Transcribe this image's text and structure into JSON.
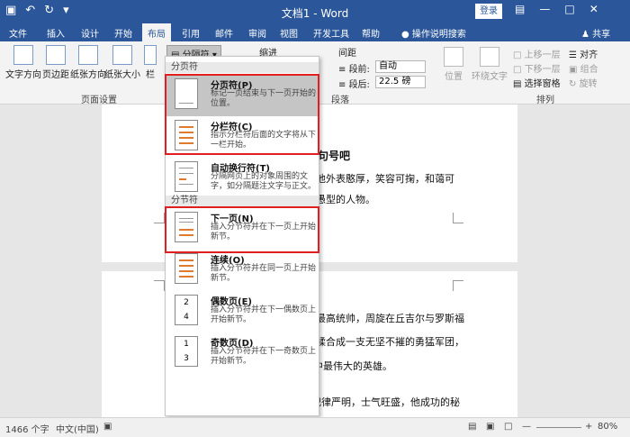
{
  "titlebar": {
    "title": "文档1 - Word",
    "login": "登录"
  },
  "tabs": [
    "文件",
    "插入",
    "设计",
    "开始",
    "布局",
    "引用",
    "邮件",
    "审阅",
    "视图",
    "开发工具",
    "帮助"
  ],
  "tell_me": "操作说明搜索",
  "share": "共享",
  "ribbon": {
    "text_direction": "文字方向",
    "margins": "页边距",
    "orientation": "纸张方向",
    "size": "纸张大小",
    "columns": "栏",
    "breaks": "分隔符",
    "page_setup": "页面设置",
    "indent": "缩进",
    "spacing": "间距",
    "before_label": "段前:",
    "before_value": "自动",
    "after_label": "段后:",
    "after_value": "22.5 磅",
    "paragraph": "段落",
    "position": "位置",
    "wrap_text": "环绕文字",
    "bring_forward": "上移一层",
    "send_backward": "下移一层",
    "selection_pane": "选择窗格",
    "align": "对齐",
    "group": "组合",
    "rotate": "旋转",
    "arrange": "排列"
  },
  "dropdown": {
    "section_page": "分页符",
    "section_section": "分节符",
    "items": [
      {
        "title": "分页符(P)",
        "desc": "标记一页结束与下一页开始的位置。"
      },
      {
        "title": "分栏符(C)",
        "desc": "指示分栏符后面的文字将从下一栏开始。"
      },
      {
        "title": "自动换行符(T)",
        "desc": "分隔网页上的对象周围的文字，如分隔题注文字与正文。"
      },
      {
        "title": "下一页(N)",
        "desc": "插入分节符并在下一页上开始新节。"
      },
      {
        "title": "连续(O)",
        "desc": "插入分节符并在同一页上开始新节。"
      },
      {
        "title": "偶数页(E)",
        "desc": "插入分节符并在下一偶数页上开始新节。"
      },
      {
        "title": "奇数页(D)",
        "desc": "插入分节符并在下一奇数页上开始新节。"
      }
    ]
  },
  "document": {
    "p1_heading_tail": "句号吧",
    "p1_line1": "他外表憨厚，笑容可掬，和蔼可",
    "p1_line2": "愚型的人物。",
    "p2_line1": "最高统帅，周旋在丘吉尔与罗斯福",
    "p2_line2": "揉合成一支无坚不摧的勇猛军团，",
    "p2_line3": "最终击败强敌，成为二次世界大战中最伟大的英雄。",
    "p2_line4": "艾森豪威尔领导的百万大军，纪律严明，士气旺盛，他成功的秘"
  },
  "status": {
    "word_count": "1466 个字",
    "language": "中文(中国)",
    "zoom": "80%"
  }
}
